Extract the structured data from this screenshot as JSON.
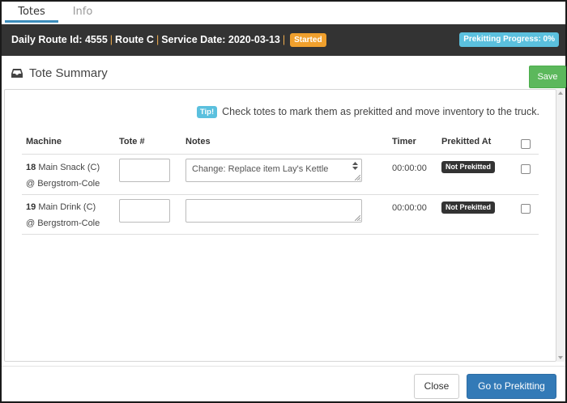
{
  "tabs": [
    {
      "label": "Totes",
      "active": true
    },
    {
      "label": "Info",
      "active": false
    }
  ],
  "header": {
    "route_id_label": "Daily Route Id: 4555",
    "route_label": "Route C",
    "service_date_label": "Service Date: 2020-03-13",
    "status_badge": "Started",
    "progress_badge": "Prekitting Progress: 0%",
    "progress_value": 0
  },
  "section": {
    "title": "Tote Summary",
    "icon": "inbox-icon",
    "save_label": "Save"
  },
  "tip": {
    "badge": "Tip!",
    "text": "Check totes to mark them as prekitted and move inventory to the truck."
  },
  "table": {
    "columns": [
      "Machine",
      "Tote #",
      "Notes",
      "Timer",
      "Prekitted At"
    ],
    "rows": [
      {
        "number": "18",
        "machine": "Main Snack (C)",
        "location": "@ Bergstrom-Cole",
        "tote": "",
        "notes": "Change: Replace item Lay's Kettle",
        "timer": "00:00:00",
        "prekitted_status": "Not Prekitted",
        "checked": false
      },
      {
        "number": "19",
        "machine": "Main Drink (C)",
        "location": "@ Bergstrom-Cole",
        "tote": "",
        "notes": "",
        "timer": "00:00:00",
        "prekitted_status": "Not Prekitted",
        "checked": false
      }
    ]
  },
  "footer": {
    "close_label": "Close",
    "go_label": "Go to Prekitting"
  },
  "colors": {
    "header_bg": "#333333",
    "started": "#f0a02d",
    "progress": "#5bc0de",
    "save": "#5cb85c",
    "primary": "#337ab7"
  }
}
